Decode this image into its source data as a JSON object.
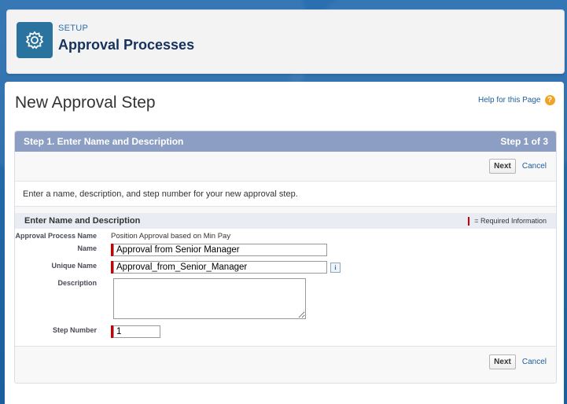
{
  "header": {
    "setup_label": "SETUP",
    "title": "Approval Processes",
    "icon": "gear-icon"
  },
  "page": {
    "title": "New Approval Step",
    "help_link": "Help for this Page",
    "help_icon": "?"
  },
  "step": {
    "title": "Step 1. Enter Name and Description",
    "indicator": "Step 1 of 3",
    "next_label": "Next",
    "cancel_label": "Cancel",
    "instructions": "Enter a name, description, and step number for your new approval step."
  },
  "section": {
    "title": "Enter Name and Description",
    "required_info": "= Required Information"
  },
  "form": {
    "approval_process_label": "Approval Process Name",
    "approval_process_value": "Position Approval based on Min Pay",
    "name_label": "Name",
    "name_value": "Approval from Senior Manager",
    "unique_name_label": "Unique Name",
    "unique_name_value": "Approval_from_Senior_Manager",
    "info_icon": "i",
    "description_label": "Description",
    "description_value": "",
    "step_number_label": "Step Number",
    "step_number_value": "1"
  },
  "colors": {
    "background": "#1b5f9e",
    "step_bar": "#8c9ec3",
    "required": "#cc0000",
    "link": "#1c5d99"
  }
}
